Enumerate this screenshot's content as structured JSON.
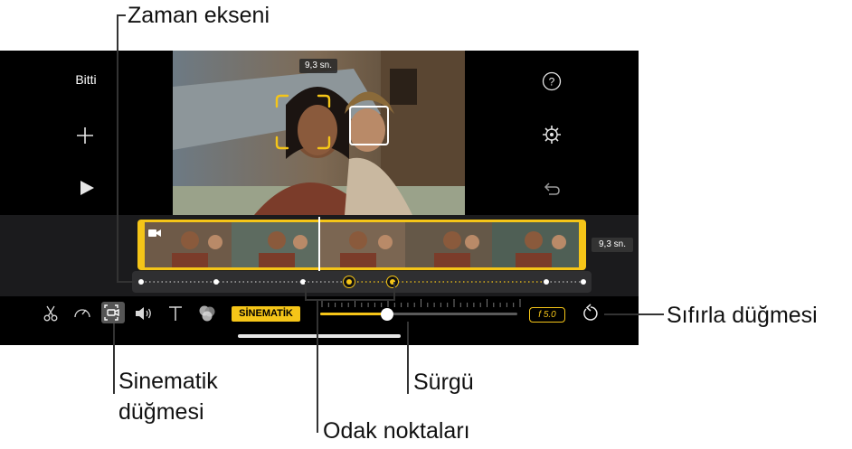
{
  "callouts": {
    "timeline": "Zaman ekseni",
    "reset_button": "Sıfırla düğmesi",
    "cinematic_button_line1": "Sinematik",
    "cinematic_button_line2": "düğmesi",
    "slider": "Sürgü",
    "focus_points": "Odak noktaları"
  },
  "editor": {
    "done_label": "Bitti",
    "playhead_time": "9,3 sn.",
    "clip_duration": "9,3 sn.",
    "cinematic_label": "SİNEMATİK",
    "aperture_label": "f 5.0",
    "slider_fraction": 0.34
  },
  "icons": {
    "add": "plus-icon",
    "play": "play-icon",
    "help": "question-icon",
    "settings": "gear-icon",
    "undo": "undo-icon",
    "scissors": "scissors-icon",
    "speed": "speedometer-icon",
    "cinematic": "cinematic-camera-icon",
    "volume": "speaker-icon",
    "title": "text-icon",
    "filters": "filters-icon",
    "reset": "reset-icon"
  },
  "colors": {
    "accent_yellow": "#f5c518",
    "background": "#000000"
  }
}
